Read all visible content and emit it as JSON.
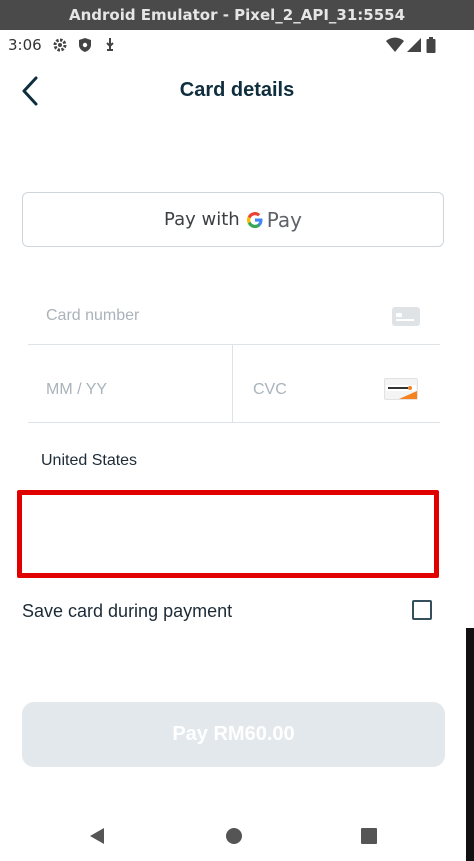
{
  "window": {
    "title": "Android Emulator - Pixel_2_API_31:5554"
  },
  "status_bar": {
    "time": "3:06",
    "left_icons": [
      "settings-gear-icon",
      "shield-icon",
      "usb-debug-icon"
    ],
    "right_icons": [
      "wifi-icon",
      "cell-signal-icon",
      "battery-icon"
    ]
  },
  "app_bar": {
    "title": "Card details",
    "back_icon": "chevron-left-icon"
  },
  "google_pay": {
    "label": "Pay with",
    "logo_g": "G",
    "logo_pay": "Pay"
  },
  "card_form": {
    "card_number_placeholder": "Card number",
    "expiry_placeholder": "MM / YY",
    "cvc_placeholder": "CVC",
    "card_brand_icon": "generic-card-icon",
    "cvc_brand_icon": "discover-card-icon",
    "country": "United States",
    "postal_placeholder": ""
  },
  "save_card": {
    "label": "Save card during payment",
    "checked": false
  },
  "pay_button": {
    "label": "Pay RM60.00"
  },
  "colors": {
    "accent_dark": "#0f2e3d",
    "highlight_border": "#e00000",
    "disabled_button": "#e2e8ec"
  }
}
